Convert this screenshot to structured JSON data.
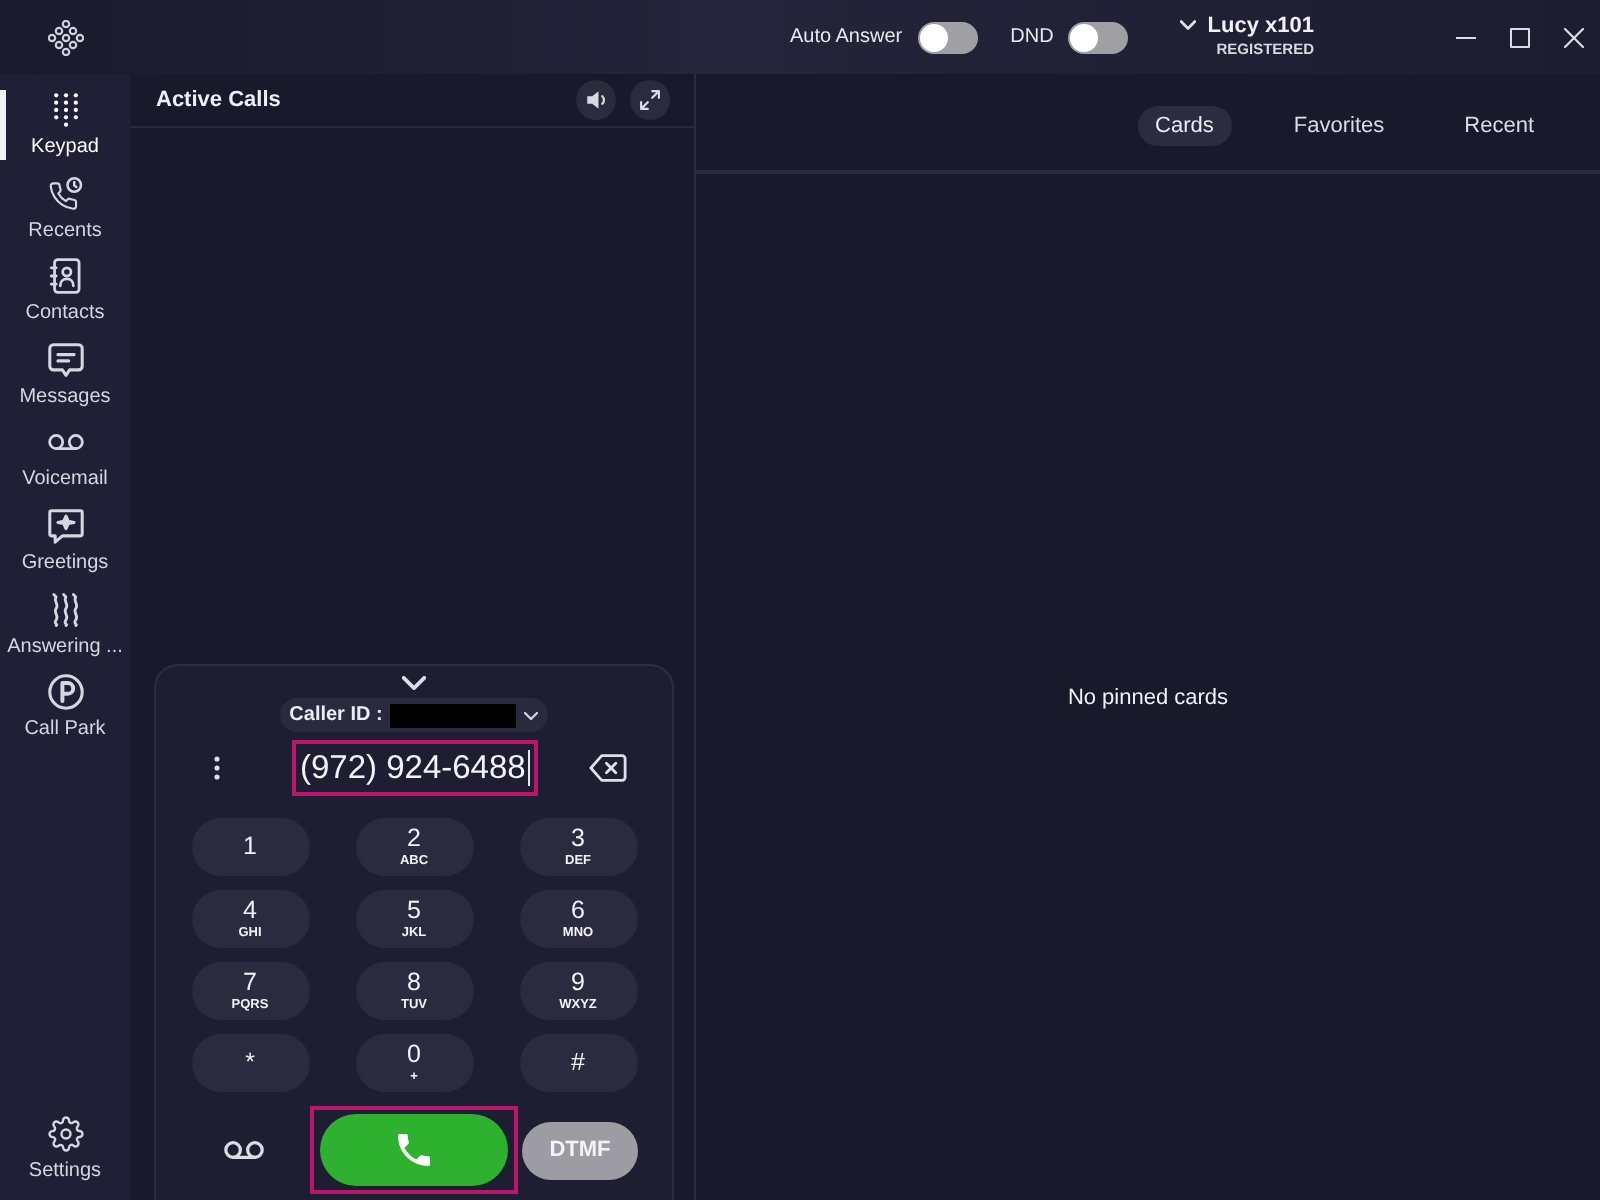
{
  "title_bar": {
    "auto_answer": {
      "label": "Auto Answer",
      "on": false
    },
    "dnd": {
      "label": "DND",
      "on": false
    },
    "account": {
      "name": "Lucy x101",
      "status": "REGISTERED"
    }
  },
  "sidebar": {
    "items": [
      {
        "kind": "keypad",
        "label": "Keypad",
        "selected": true
      },
      {
        "kind": "recents",
        "label": "Recents",
        "selected": false
      },
      {
        "kind": "contacts",
        "label": "Contacts",
        "selected": false
      },
      {
        "kind": "messages",
        "label": "Messages",
        "selected": false
      },
      {
        "kind": "voicemail",
        "label": "Voicemail",
        "selected": false
      },
      {
        "kind": "greetings",
        "label": "Greetings",
        "selected": false
      },
      {
        "kind": "answering",
        "label": "Answering ...",
        "selected": false
      },
      {
        "kind": "call_park",
        "label": "Call Park",
        "selected": false
      }
    ],
    "footer": {
      "label": "Settings"
    }
  },
  "active_calls": {
    "title": "Active Calls"
  },
  "dialer": {
    "caller_id": {
      "label": "Caller ID :",
      "redacted": true
    },
    "number": {
      "value": "(972) 924-6488",
      "highlighted": true
    },
    "keys": [
      {
        "digit": "1"
      },
      {
        "digit": "2",
        "letters": "ABC"
      },
      {
        "digit": "3",
        "letters": "DEF"
      },
      {
        "digit": "4",
        "letters": "GHI"
      },
      {
        "digit": "5",
        "letters": "JKL"
      },
      {
        "digit": "6",
        "letters": "MNO"
      },
      {
        "digit": "7",
        "letters": "PQRS"
      },
      {
        "digit": "8",
        "letters": "TUV"
      },
      {
        "digit": "9",
        "letters": "WXYZ"
      },
      {
        "digit": "*"
      },
      {
        "digit": "0",
        "letters": "+"
      },
      {
        "digit": "#"
      }
    ],
    "call_button": {
      "highlighted": true
    },
    "dtmf_button": {
      "label": "DTMF",
      "disabled": true
    }
  },
  "cards_panel": {
    "tabs": [
      {
        "label": "Cards",
        "selected": true
      },
      {
        "label": "Favorites",
        "selected": false
      },
      {
        "label": "Recent",
        "selected": false
      }
    ],
    "empty_message": "No pinned cards"
  }
}
